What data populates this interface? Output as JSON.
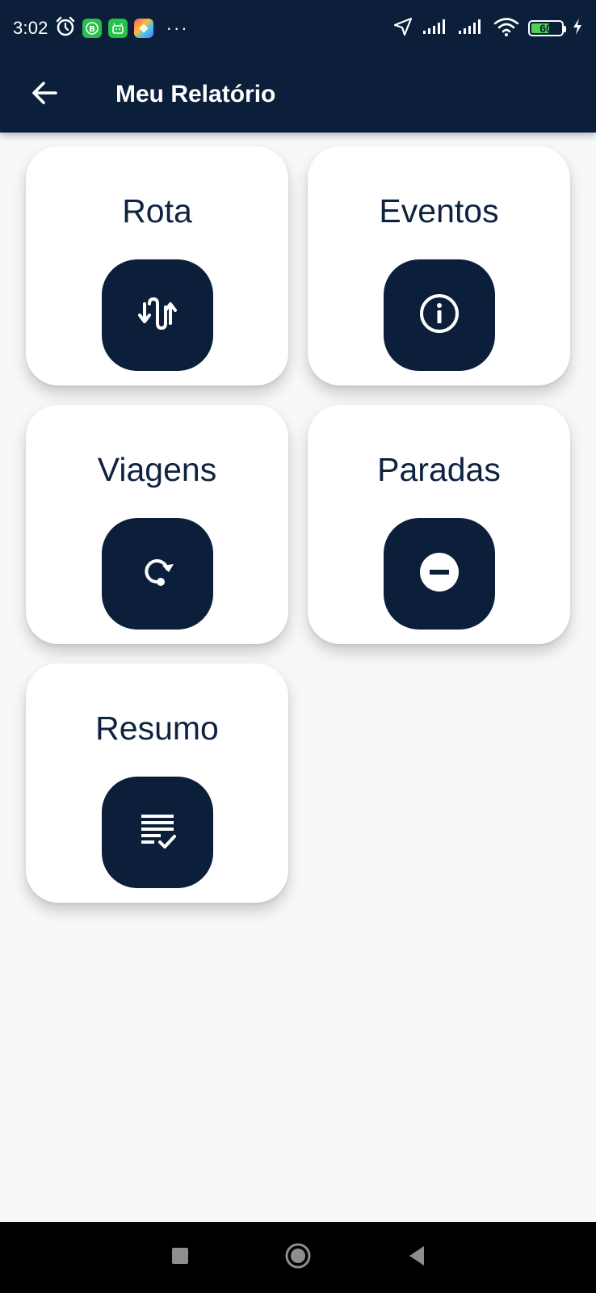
{
  "status_bar": {
    "time": "3:02",
    "battery_level": "60",
    "battery_fraction": 0.6,
    "overflow": "···",
    "icons": [
      "alarm-icon",
      "app-b-icon",
      "app-android-icon",
      "app-colorful-icon",
      "location-arrow-icon",
      "signal-icon",
      "signal-icon",
      "wifi-icon",
      "battery-icon",
      "charging-icon"
    ]
  },
  "app_bar": {
    "title": "Meu Relatório",
    "back_icon": "arrow-left-icon"
  },
  "cards": [
    {
      "label": "Rota",
      "icon": "route-icon"
    },
    {
      "label": "Eventos",
      "icon": "info-icon"
    },
    {
      "label": "Viagens",
      "icon": "trip-icon"
    },
    {
      "label": "Paradas",
      "icon": "stop-icon"
    },
    {
      "label": "Resumo",
      "icon": "summary-icon"
    }
  ],
  "nav_bar": {
    "icons": [
      "recents-icon",
      "home-icon",
      "back-icon"
    ]
  },
  "colors": {
    "primary": "#0b1f3b",
    "background": "#f7f8fa",
    "card": "#ffffff",
    "text": "#0f2340"
  }
}
